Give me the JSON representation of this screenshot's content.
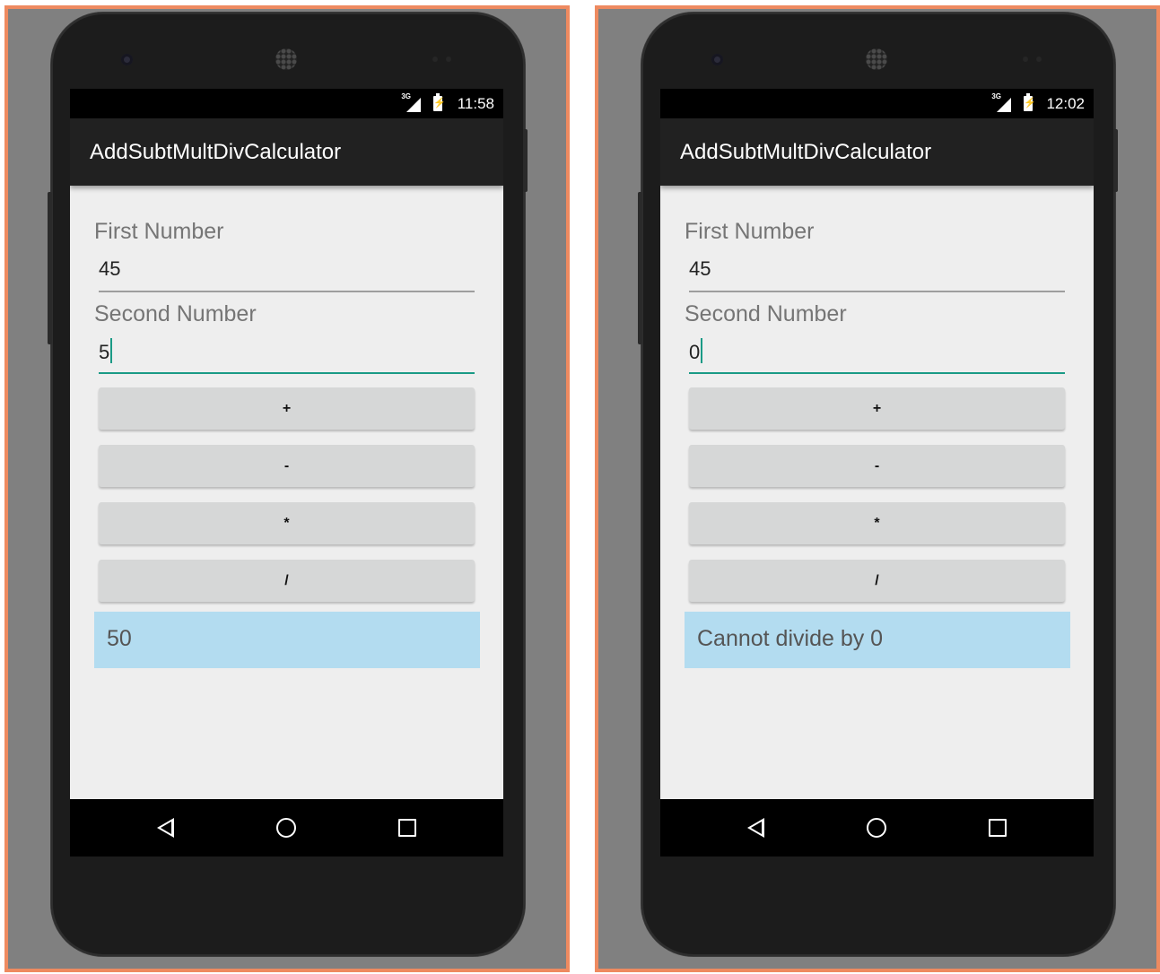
{
  "screens": [
    {
      "status_time": "11:58",
      "network": "3G",
      "app_title": "AddSubtMultDivCalculator",
      "first_label": "First Number",
      "first_value": "45",
      "second_label": "Second Number",
      "second_value": "5",
      "buttons": {
        "add": "+",
        "subtract": "-",
        "multiply": "*",
        "divide": "/"
      },
      "result": "50"
    },
    {
      "status_time": "12:02",
      "network": "3G",
      "app_title": "AddSubtMultDivCalculator",
      "first_label": "First Number",
      "first_value": "45",
      "second_label": "Second Number",
      "second_value": "0",
      "buttons": {
        "add": "+",
        "subtract": "-",
        "multiply": "*",
        "divide": "/"
      },
      "result": "Cannot divide by 0"
    }
  ],
  "colors": {
    "frame_border": "#ee8a60",
    "frame_bg": "#808080",
    "appbar": "#212121",
    "focus_underline": "#1a9a86",
    "result_bg": "#b3dcf0",
    "button_bg": "#d6d7d7"
  },
  "icons": {
    "nav_back": "back-triangle-icon",
    "nav_home": "home-circle-icon",
    "nav_recent": "recent-apps-square-icon",
    "status_signal": "signal-icon",
    "status_battery": "battery-charging-icon"
  }
}
